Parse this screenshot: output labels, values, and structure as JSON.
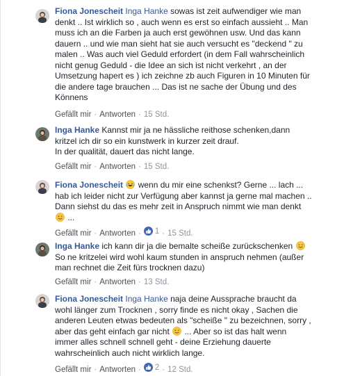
{
  "comments": [
    {
      "author": "Fiona Jonescheit",
      "mention": "Inga Hanke",
      "lines": [
        " sowas ist zeit aufwendiger wie man",
        "denkt .. Ist wirklich so , auch wenn es erst so einfach aussieht .. Man",
        "muss ich an die Farben ja auch erst gewöhnen usw. Und das kann",
        "dauern .. und wie man sieht hat sie auch versucht es \"deckend \" zu",
        "malen .. Was auch viel Geduld erfordert (in dem Fall wahrscheinlich",
        "nicht genug Geduld - die Idee an sich ist nicht verkehrt , an der",
        "Umsetzung hapert es ) ich zeichne zb auch Figuren in 10 Minuten für",
        "die andere tage brauchen ... Das ist ne sache der Übung und des",
        "Könnens"
      ],
      "like": "Gefällt mir",
      "reply": "Antworten",
      "time": "15 Std."
    },
    {
      "author": "Inga Hanke",
      "lines": [
        " Kannst mir ja ne hässliche reithose schenken,dann",
        "kritzel ich dir so ein kunstwerk in kurzer zeit drauf.",
        "In der qualität, dauert das nicht lange."
      ],
      "like": "Gefällt mir",
      "reply": "Antworten",
      "time": "15 Std."
    },
    {
      "author": "Fiona Jonescheit",
      "lines": [
        " wenn du mir eine schenkst? Gerne ... lach ...",
        "hab ich leider nicht zur Verfügung aber kannst ja gerne mal machen ..",
        "Dann siehst du das es mehr zeit in Anspruch nimmt wie man denkt",
        " ..."
      ],
      "like": "Gefällt mir",
      "reply": "Antworten",
      "reactions": "1",
      "time": "15 Std."
    },
    {
      "author": "Inga Hanke",
      "lines": [
        " ich kann dir ja die bemalte scheiße zurückschenken",
        "So ne kritzelei wird wohl kaum stunden in anspruch nehmen (außer",
        "man rechnet die Zeit fürs trocknen dazu)"
      ],
      "like": "Gefällt mir",
      "reply": "Antworten",
      "time": "13 Std."
    },
    {
      "author": "Fiona Jonescheit",
      "mention": "Inga Hanke",
      "lines": [
        " naja deine Aussprache braucht da",
        "wohl länger zum Trocknen , sorry finde es nicht okay , Sachen die",
        "anderen Leuten etwas bedeuten als \"scheiße \" zu bezeichnen, sorry ,",
        "aber das geht einfach gar nicht",
        " ... Aber so ist das halt wenn",
        "immer alles schnell schnell geht - deine Erziehung dauerte",
        "wahrscheinlich auch nicht wirklich lange."
      ],
      "like": "Gefällt mir",
      "reply": "Antworten",
      "reactions": "2",
      "time": "12 Std."
    }
  ],
  "colors": {
    "link": "#365899",
    "meta": "#90949c",
    "text": "#1d2129",
    "like_badge": "#4267b2"
  },
  "icons": {
    "smile": "smile-emoji-icon",
    "laugh": "laughing-emoji-icon",
    "like": "thumbs-up-icon"
  }
}
